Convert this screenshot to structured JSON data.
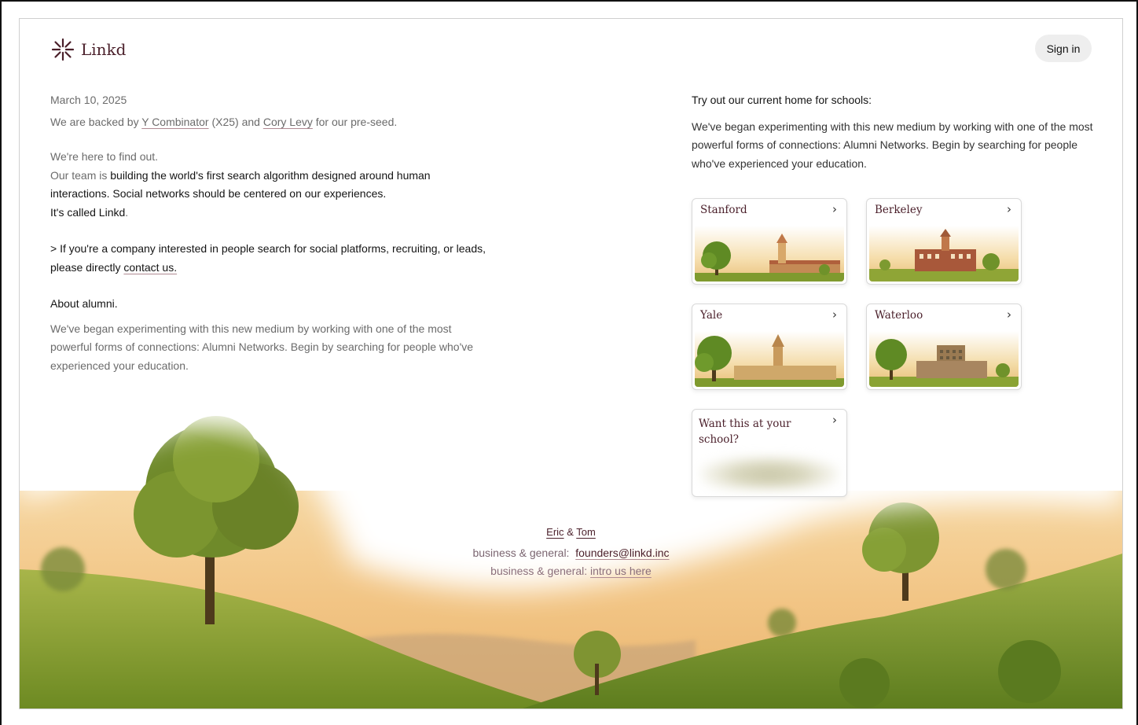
{
  "brand": {
    "name": "Linkd",
    "color": "#4a1f2a"
  },
  "header": {
    "sign_in_label": "Sign in"
  },
  "intro": {
    "date": "March 10, 2025",
    "backed_prefix": "We are backed by ",
    "investor_1": "Y Combinator",
    "backed_mid": " (X25) and ",
    "investor_2": "Cory Levy",
    "backed_suffix": " for our pre-seed.",
    "find_out": "We're here to find out.",
    "team_prefix": "Our team is ",
    "team_text": "building the world's first search algorithm designed around human interactions. Social networks should be centered on our experiences.",
    "called": "It's called Linkd",
    "called_period": ".",
    "company_text": "> If you're a company interested in people search for social platforms, recruiting, or leads, please directly ",
    "contact_link": "contact us.",
    "about_heading": "About alumni.",
    "about_text": "We've began experimenting with this new medium by working with one of the most powerful forms of connections: Alumni Networks. Begin by searching for people who've experienced your education."
  },
  "schools_section": {
    "heading": "Try out our current home for schools:",
    "description": "We've began experimenting with this new medium by working with one of the most powerful forms of connections: Alumni Networks. Begin by searching for people who've experienced your education.",
    "cards": [
      {
        "name": "Stanford",
        "chevron": "›"
      },
      {
        "name": "Berkeley",
        "chevron": "›"
      },
      {
        "name": "Yale",
        "chevron": "›"
      },
      {
        "name": "Waterloo",
        "chevron": "›"
      }
    ],
    "request_card": {
      "text": "Want this at your school?",
      "chevron": "›"
    }
  },
  "footer": {
    "founder_1": "Eric",
    "amp": "&",
    "founder_2": "Tom",
    "contact_label_1": "business & general:",
    "email": "founders@linkd.inc",
    "contact_label_2": "business & general:",
    "intro_link": "intro us here"
  },
  "colors": {
    "accent": "#4a1f2a",
    "meadow": "#8da33a",
    "haze": "#f3c98a"
  }
}
